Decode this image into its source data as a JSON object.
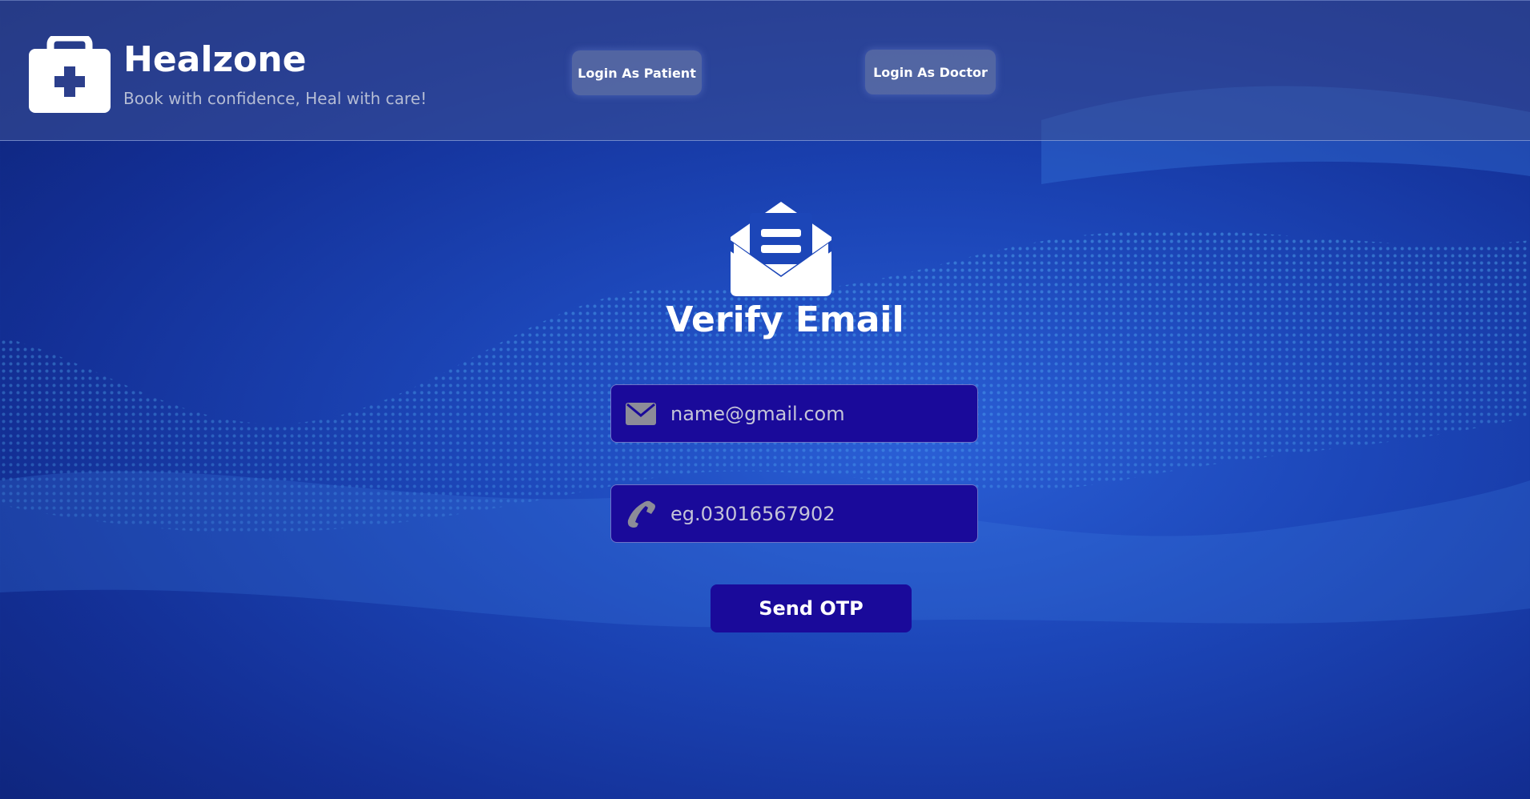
{
  "header": {
    "brand_title": "Healzone",
    "brand_tagline": "Book with confidence, Heal with care!",
    "logo_icon": "medical-kit-icon",
    "nav": {
      "patient_login_label": "Login As Patient",
      "doctor_login_label": "Login As Doctor"
    }
  },
  "main": {
    "hero_icon": "open-envelope-icon",
    "title": "Verify Email",
    "email_field": {
      "icon": "envelope-icon",
      "placeholder": "name@gmail.com",
      "value": ""
    },
    "phone_field": {
      "icon": "phone-icon",
      "placeholder": "eg.03016567902",
      "value": ""
    },
    "send_button_label": "Send OTP"
  },
  "colors": {
    "background": "#1c46b8",
    "field_background": "#1a0a9a",
    "button_background": "#1a0a9a",
    "header_overlay": "#3c5096",
    "text": "#ffffff",
    "placeholder": "#c4c4d8"
  }
}
